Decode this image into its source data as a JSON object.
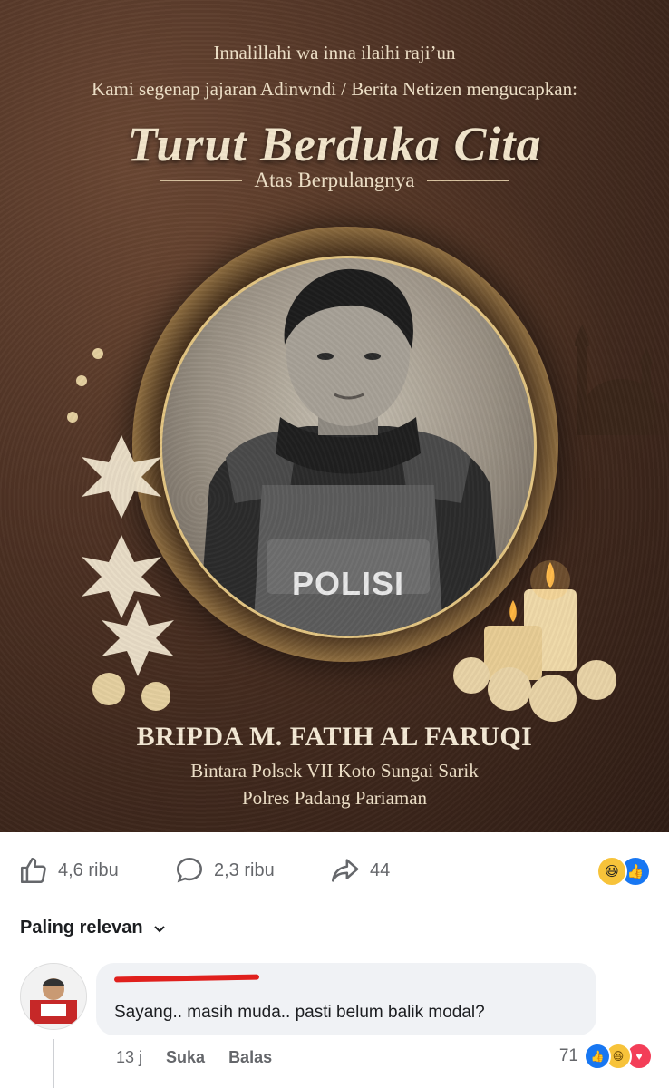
{
  "poster": {
    "line1": "Innalillahi wa inna ilaihi raji’un",
    "line2": "Kami segenap jajaran Adinwndi / Berita Netizen mengucapkan:",
    "title": "Turut Berduka Cita",
    "subtitle": "Atas Berpulangnya",
    "vest_text": "POLISI",
    "name": "BRIPDA M. FATIH AL FARUQI",
    "role1": "Bintara Polsek VII Koto Sungai Sarik",
    "role2": "Polres Padang Pariaman"
  },
  "post_actions": {
    "likes": "4,6 ribu",
    "comments": "2,3 ribu",
    "shares": "44",
    "reaction_icons": [
      "haha-icon",
      "like-icon"
    ]
  },
  "comments_section": {
    "sort_label": "Paling relevan"
  },
  "comment": {
    "text": "Sayang.. masih muda.. pasti belum balik modal?",
    "time": "13 j",
    "like_label": "Suka",
    "reply_label": "Balas",
    "reaction_count": "71"
  },
  "colors": {
    "poster_bg": "#4a2f22",
    "gold": "#d4ad6a",
    "fb_blue": "#1877f2",
    "muted_text": "#65676b",
    "bubble_bg": "#f0f2f5"
  }
}
